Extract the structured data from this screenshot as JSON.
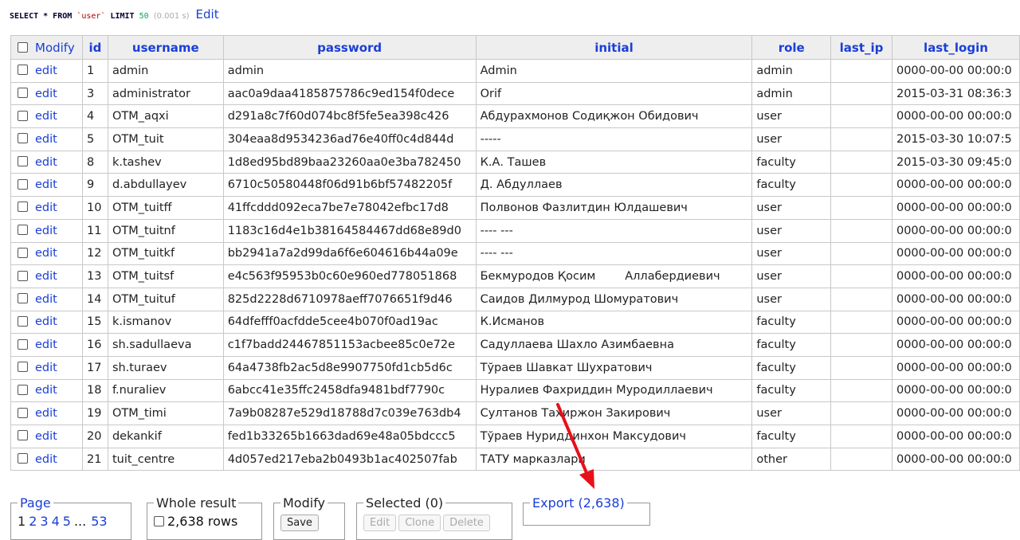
{
  "query": {
    "select": "SELECT * FROM",
    "table": "`user`",
    "limit": "LIMIT",
    "limit_value": "50",
    "time": "(0.001 s)",
    "edit_label": "Edit"
  },
  "table": {
    "modify_header": "Modify",
    "columns": [
      "id",
      "username",
      "password",
      "initial",
      "role",
      "last_ip",
      "last_login"
    ],
    "edit_label": "edit",
    "rows": [
      {
        "id": "1",
        "username": "admin",
        "password": "admin",
        "initial": "Admin",
        "role": "admin",
        "last_ip": "",
        "last_login": "0000-00-00 00:00:0"
      },
      {
        "id": "3",
        "username": "administrator",
        "password": "aac0a9daa4185875786c9ed154f0dece",
        "initial": "Orif",
        "role": "admin",
        "last_ip": "",
        "last_login": "2015-03-31 08:36:3"
      },
      {
        "id": "4",
        "username": "OTM_aqxi",
        "password": "d291a8c7f60d074bc8f5fe5ea398c426",
        "initial": "Абдурахмонов Содиқжон Обидович",
        "role": "user",
        "last_ip": "",
        "last_login": "0000-00-00 00:00:0"
      },
      {
        "id": "5",
        "username": "OTM_tuit",
        "password": "304eaa8d9534236ad76e40ff0c4d844d",
        "initial": "-----",
        "role": "user",
        "last_ip": "",
        "last_login": "2015-03-30 10:07:5"
      },
      {
        "id": "8",
        "username": "k.tashev",
        "password": "1d8ed95bd89baa23260aa0e3ba782450",
        "initial": "К.А. Ташев",
        "role": "faculty",
        "last_ip": "",
        "last_login": "2015-03-30 09:45:0"
      },
      {
        "id": "9",
        "username": "d.abdullayev",
        "password": "6710c50580448f06d91b6bf57482205f",
        "initial": "Д. Абдуллаев",
        "role": "faculty",
        "last_ip": "",
        "last_login": "0000-00-00 00:00:0"
      },
      {
        "id": "10",
        "username": "OTM_tuitff",
        "password": "41ffcddd092eca7be7e78042efbc17d8",
        "initial": "Полвонов Фазлитдин Юлдашевич",
        "role": "user",
        "last_ip": "",
        "last_login": "0000-00-00 00:00:0"
      },
      {
        "id": "11",
        "username": "OTM_tuitnf",
        "password": "1183c16d4e1b38164584467dd68e89d0",
        "initial": "---- ---",
        "role": "user",
        "last_ip": "",
        "last_login": "0000-00-00 00:00:0"
      },
      {
        "id": "12",
        "username": "OTM_tuitkf",
        "password": "bb2941a7a2d99da6f6e604616b44a09e",
        "initial": "---- ---",
        "role": "user",
        "last_ip": "",
        "last_login": "0000-00-00 00:00:0"
      },
      {
        "id": "13",
        "username": "OTM_tuitsf",
        "password": "e4c563f95953b0c60e960ed778051868",
        "initial": "Бекмуродов Қосим        Аллабердиевич",
        "role": "user",
        "last_ip": "",
        "last_login": "0000-00-00 00:00:0"
      },
      {
        "id": "14",
        "username": "OTM_tuituf",
        "password": "825d2228d6710978aeff7076651f9d46",
        "initial": "Саидов Дилмурод Шомуратович",
        "role": "user",
        "last_ip": "",
        "last_login": "0000-00-00 00:00:0"
      },
      {
        "id": "15",
        "username": "k.ismanov",
        "password": "64dfefff0acfdde5cee4b070f0ad19ac",
        "initial": "К.Исманов",
        "role": "faculty",
        "last_ip": "",
        "last_login": "0000-00-00 00:00:0"
      },
      {
        "id": "16",
        "username": "sh.sadullaeva",
        "password": "c1f7badd24467851153acbee85c0e72e",
        "initial": "Садуллаева Шахло Азимбаевна",
        "role": "faculty",
        "last_ip": "",
        "last_login": "0000-00-00 00:00:0"
      },
      {
        "id": "17",
        "username": "sh.turaev",
        "password": "64a4738fb2ac5d8e9907750fd1cb5d6c",
        "initial": "Тўраев Шавкат Шухратович",
        "role": "faculty",
        "last_ip": "",
        "last_login": "0000-00-00 00:00:0"
      },
      {
        "id": "18",
        "username": "f.nuraliev",
        "password": "6abcc41e35ffc2458dfa9481bdf7790c",
        "initial": "Нуралиев Фахриддин Муродиллаевич",
        "role": "faculty",
        "last_ip": "",
        "last_login": "0000-00-00 00:00:0"
      },
      {
        "id": "19",
        "username": "OTM_timi",
        "password": "7a9b08287e529d18788d7c039e763db4",
        "initial": "Султанов Тахиржон Закирович",
        "role": "user",
        "last_ip": "",
        "last_login": "0000-00-00 00:00:0"
      },
      {
        "id": "20",
        "username": "dekankif",
        "password": "fed1b33265b1663dad69e48a05bdccc5",
        "initial": "Тўраев Нуриддинхон Максудович",
        "role": "faculty",
        "last_ip": "",
        "last_login": "0000-00-00 00:00:0"
      },
      {
        "id": "21",
        "username": "tuit_centre",
        "password": "4d057ed217eba2b0493b1ac402507fab",
        "initial": "ТАТУ марказлари",
        "role": "other",
        "last_ip": "",
        "last_login": "0000-00-00 00:00:0"
      }
    ]
  },
  "footer": {
    "page_legend": "Page",
    "pages": [
      "1",
      "2",
      "3",
      "4",
      "5",
      "53"
    ],
    "ellipsis": "...",
    "whole_result_legend": "Whole result",
    "rows_label": "2,638 rows",
    "modify_legend": "Modify",
    "save_label": "Save",
    "selected_legend": "Selected (0)",
    "edit_label": "Edit",
    "clone_label": "Clone",
    "delete_label": "Delete",
    "export_legend": "Export (2,638)"
  },
  "colors": {
    "link": "#1a3fd6",
    "arrow": "#e8101a"
  }
}
